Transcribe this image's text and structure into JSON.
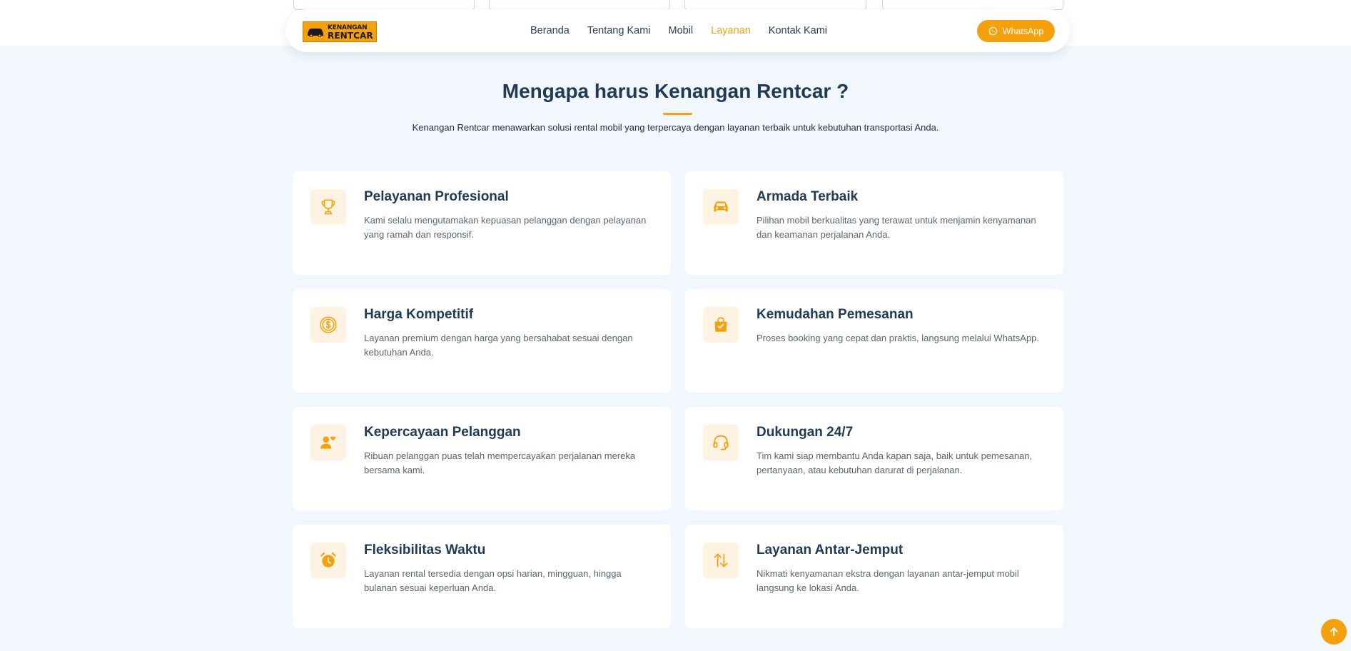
{
  "brand": {
    "logo_line1": "KENANGAN",
    "logo_line2": "RENTCAR"
  },
  "nav": {
    "items": [
      {
        "label": "Beranda"
      },
      {
        "label": "Tentang Kami"
      },
      {
        "label": "Mobil"
      },
      {
        "label": "Layanan",
        "active": true
      },
      {
        "label": "Kontak Kami"
      }
    ],
    "whatsapp_label": "WhatsApp"
  },
  "section": {
    "title": "Mengapa harus Kenangan Rentcar ?",
    "subtitle": "Kenangan Rentcar menawarkan solusi rental mobil yang terpercaya dengan layanan terbaik untuk kebutuhan transportasi Anda."
  },
  "features": [
    {
      "icon": "trophy-icon",
      "title": "Pelayanan Profesional",
      "desc": "Kami selalu mengutamakan kepuasan pelanggan dengan pelayanan yang ramah dan responsif."
    },
    {
      "icon": "car-icon",
      "title": "Armada Terbaik",
      "desc": "Pilihan mobil berkualitas yang terawat untuk menjamin kenyamanan dan keamanan perjalanan Anda."
    },
    {
      "icon": "coin-icon",
      "title": "Harga Kompetitif",
      "desc": "Layanan premium dengan harga yang bersahabat sesuai dengan kebutuhan Anda."
    },
    {
      "icon": "shopping-bag-icon",
      "title": "Kemudahan Pemesanan",
      "desc": "Proses booking yang cepat dan praktis, langsung melalui WhatsApp."
    },
    {
      "icon": "user-heart-icon",
      "title": "Kepercayaan Pelanggan",
      "desc": "Ribuan pelanggan puas telah mempercayakan perjalanan mereka bersama kami."
    },
    {
      "icon": "headset-icon",
      "title": "Dukungan 24/7",
      "desc": "Tim kami siap membantu Anda kapan saja, baik untuk pemesanan, pertanyaan, atau kebutuhan darurat di perjalanan."
    },
    {
      "icon": "alarm-clock-icon",
      "title": "Fleksibilitas Waktu",
      "desc": "Layanan rental tersedia dengan opsi harian, mingguan, hingga bulanan sesuai keperluan Anda."
    },
    {
      "icon": "swap-arrows-icon",
      "title": "Layanan Antar-Jemput",
      "desc": "Nikmati kenyamanan ekstra dengan layanan antar-jemput mobil langsung ke lokasi Anda."
    }
  ],
  "colors": {
    "accent": "#f5a10d",
    "heading": "#1f3a56",
    "background": "#f1f7fc"
  }
}
